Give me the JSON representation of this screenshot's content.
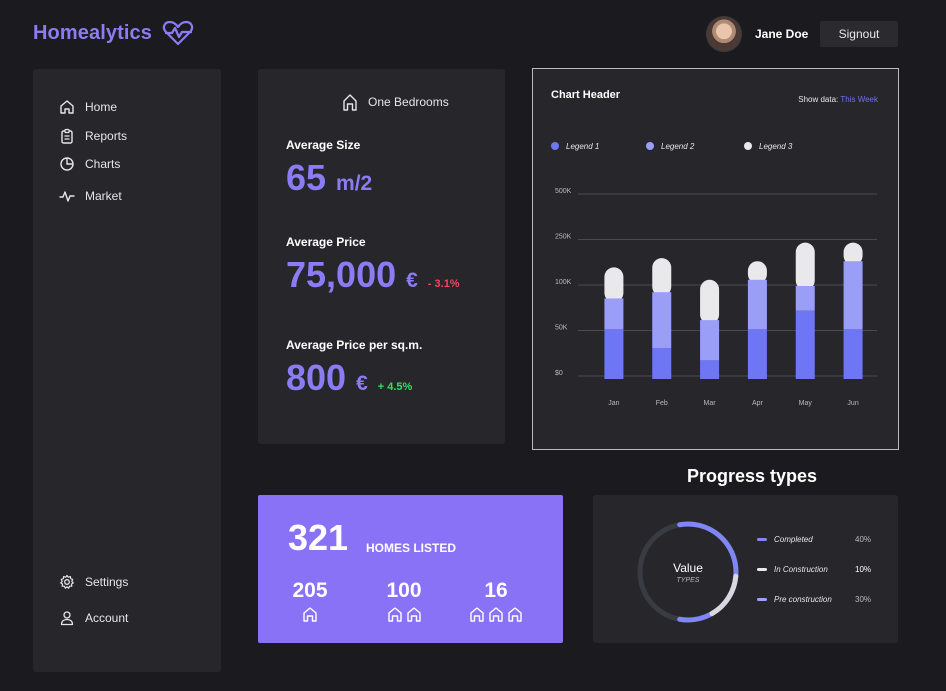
{
  "app": {
    "title": "Homealytics"
  },
  "user": {
    "name": "Jane Doe",
    "signout_label": "Signout"
  },
  "sidebar": {
    "items": [
      {
        "label": "Home",
        "icon": "home-icon"
      },
      {
        "label": "Reports",
        "icon": "clipboard-icon"
      },
      {
        "label": "Charts",
        "icon": "pie-chart-icon"
      },
      {
        "label": "Market",
        "icon": "pulse-icon"
      }
    ],
    "bottom": [
      {
        "label": "Settings",
        "icon": "gear-icon"
      },
      {
        "label": "Account",
        "icon": "user-icon"
      }
    ]
  },
  "stats": {
    "header": "One Bedrooms",
    "avg_size": {
      "label": "Average Size",
      "value": "65",
      "unit": "m/2"
    },
    "avg_price": {
      "label": "Average Price",
      "value": "75,000",
      "unit": "€",
      "change": "- 3.1%"
    },
    "avg_price_sqm": {
      "label": "Average Price per sq.m.",
      "value": "800",
      "unit": "€",
      "change": "+ 4.5%"
    }
  },
  "chart": {
    "header": "Chart Header",
    "show_data_label": "Show data:",
    "show_data_value": "This Week"
  },
  "chart_data": {
    "type": "bar",
    "stacked": true,
    "categories": [
      "Jan",
      "Feb",
      "Mar",
      "Apr",
      "May",
      "Jun"
    ],
    "y_tick_labels": [
      "$0",
      "50K",
      "100K",
      "250K",
      "500K"
    ],
    "series": [
      {
        "name": "Legend 1",
        "color": "#6e76f5",
        "values": [
          0.8,
          0.5,
          0.3,
          0.8,
          1.1,
          0.8
        ]
      },
      {
        "name": "Legend 2",
        "color": "#9a9ef7",
        "values": [
          0.5,
          0.9,
          0.65,
          0.8,
          0.4,
          1.1
        ]
      },
      {
        "name": "Legend 3",
        "color": "#e9e9ec",
        "values": [
          0.5,
          0.55,
          0.65,
          0.3,
          0.7,
          0.3
        ]
      }
    ],
    "grid": true,
    "legend_position": "top"
  },
  "homes": {
    "total": "321",
    "label": "HOMES LISTED",
    "breakdown": [
      {
        "count": "205",
        "houses": 1
      },
      {
        "count": "100",
        "houses": 2
      },
      {
        "count": "16",
        "houses": 3
      }
    ]
  },
  "progress": {
    "title": "Progress types",
    "center_value": "Value",
    "center_sub": "TYPES",
    "items": [
      {
        "label": "Completed",
        "pct": "40%",
        "color": "#7f86f5"
      },
      {
        "label": "In Construction",
        "pct": "10%",
        "color": "#e9e9ec"
      },
      {
        "label": "Pre construction",
        "pct": "30%",
        "color": "#9ea2f7"
      }
    ]
  },
  "colors": {
    "accent": "#8b7cf6",
    "background": "#1b1b1f",
    "panel": "#27272b",
    "negative": "#f0475a",
    "positive": "#32e05c"
  }
}
